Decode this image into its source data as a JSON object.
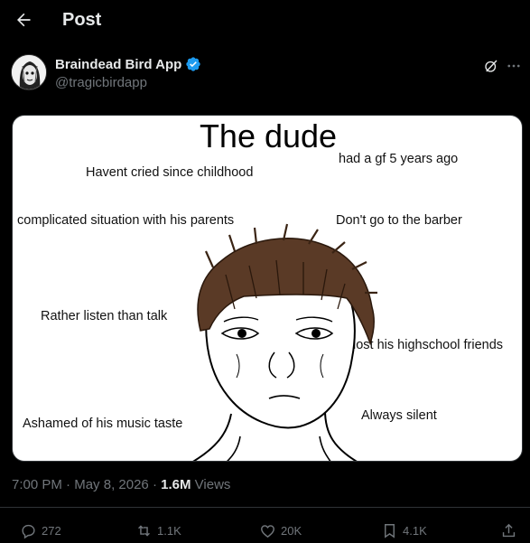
{
  "header": {
    "title": "Post",
    "back_icon": "arrow-left-icon"
  },
  "author": {
    "display_name": "Braindead Bird App",
    "handle": "@tragicbirdapp",
    "verified": true,
    "verified_color": "#1d9bf0"
  },
  "media": {
    "title": "The dude",
    "labels": [
      "Havent cried since childhood",
      "had a gf 5 years ago",
      "complicated situation with his parents",
      "Don't go to the barber",
      "Rather listen than talk",
      "lost his highschool friends",
      "Ashamed of his music taste",
      "Always silent"
    ]
  },
  "meta": {
    "time": "7:00 PM",
    "separator": "·",
    "date": "May 8, 2026",
    "views_count": "1.6M",
    "views_label": "Views"
  },
  "actions": {
    "replies": "272",
    "reposts": "1.1K",
    "likes": "20K",
    "bookmarks": "4.1K"
  },
  "colors": {
    "background": "#000000",
    "text": "#e7e9ea",
    "muted": "#71767b",
    "border": "#2f3336"
  }
}
